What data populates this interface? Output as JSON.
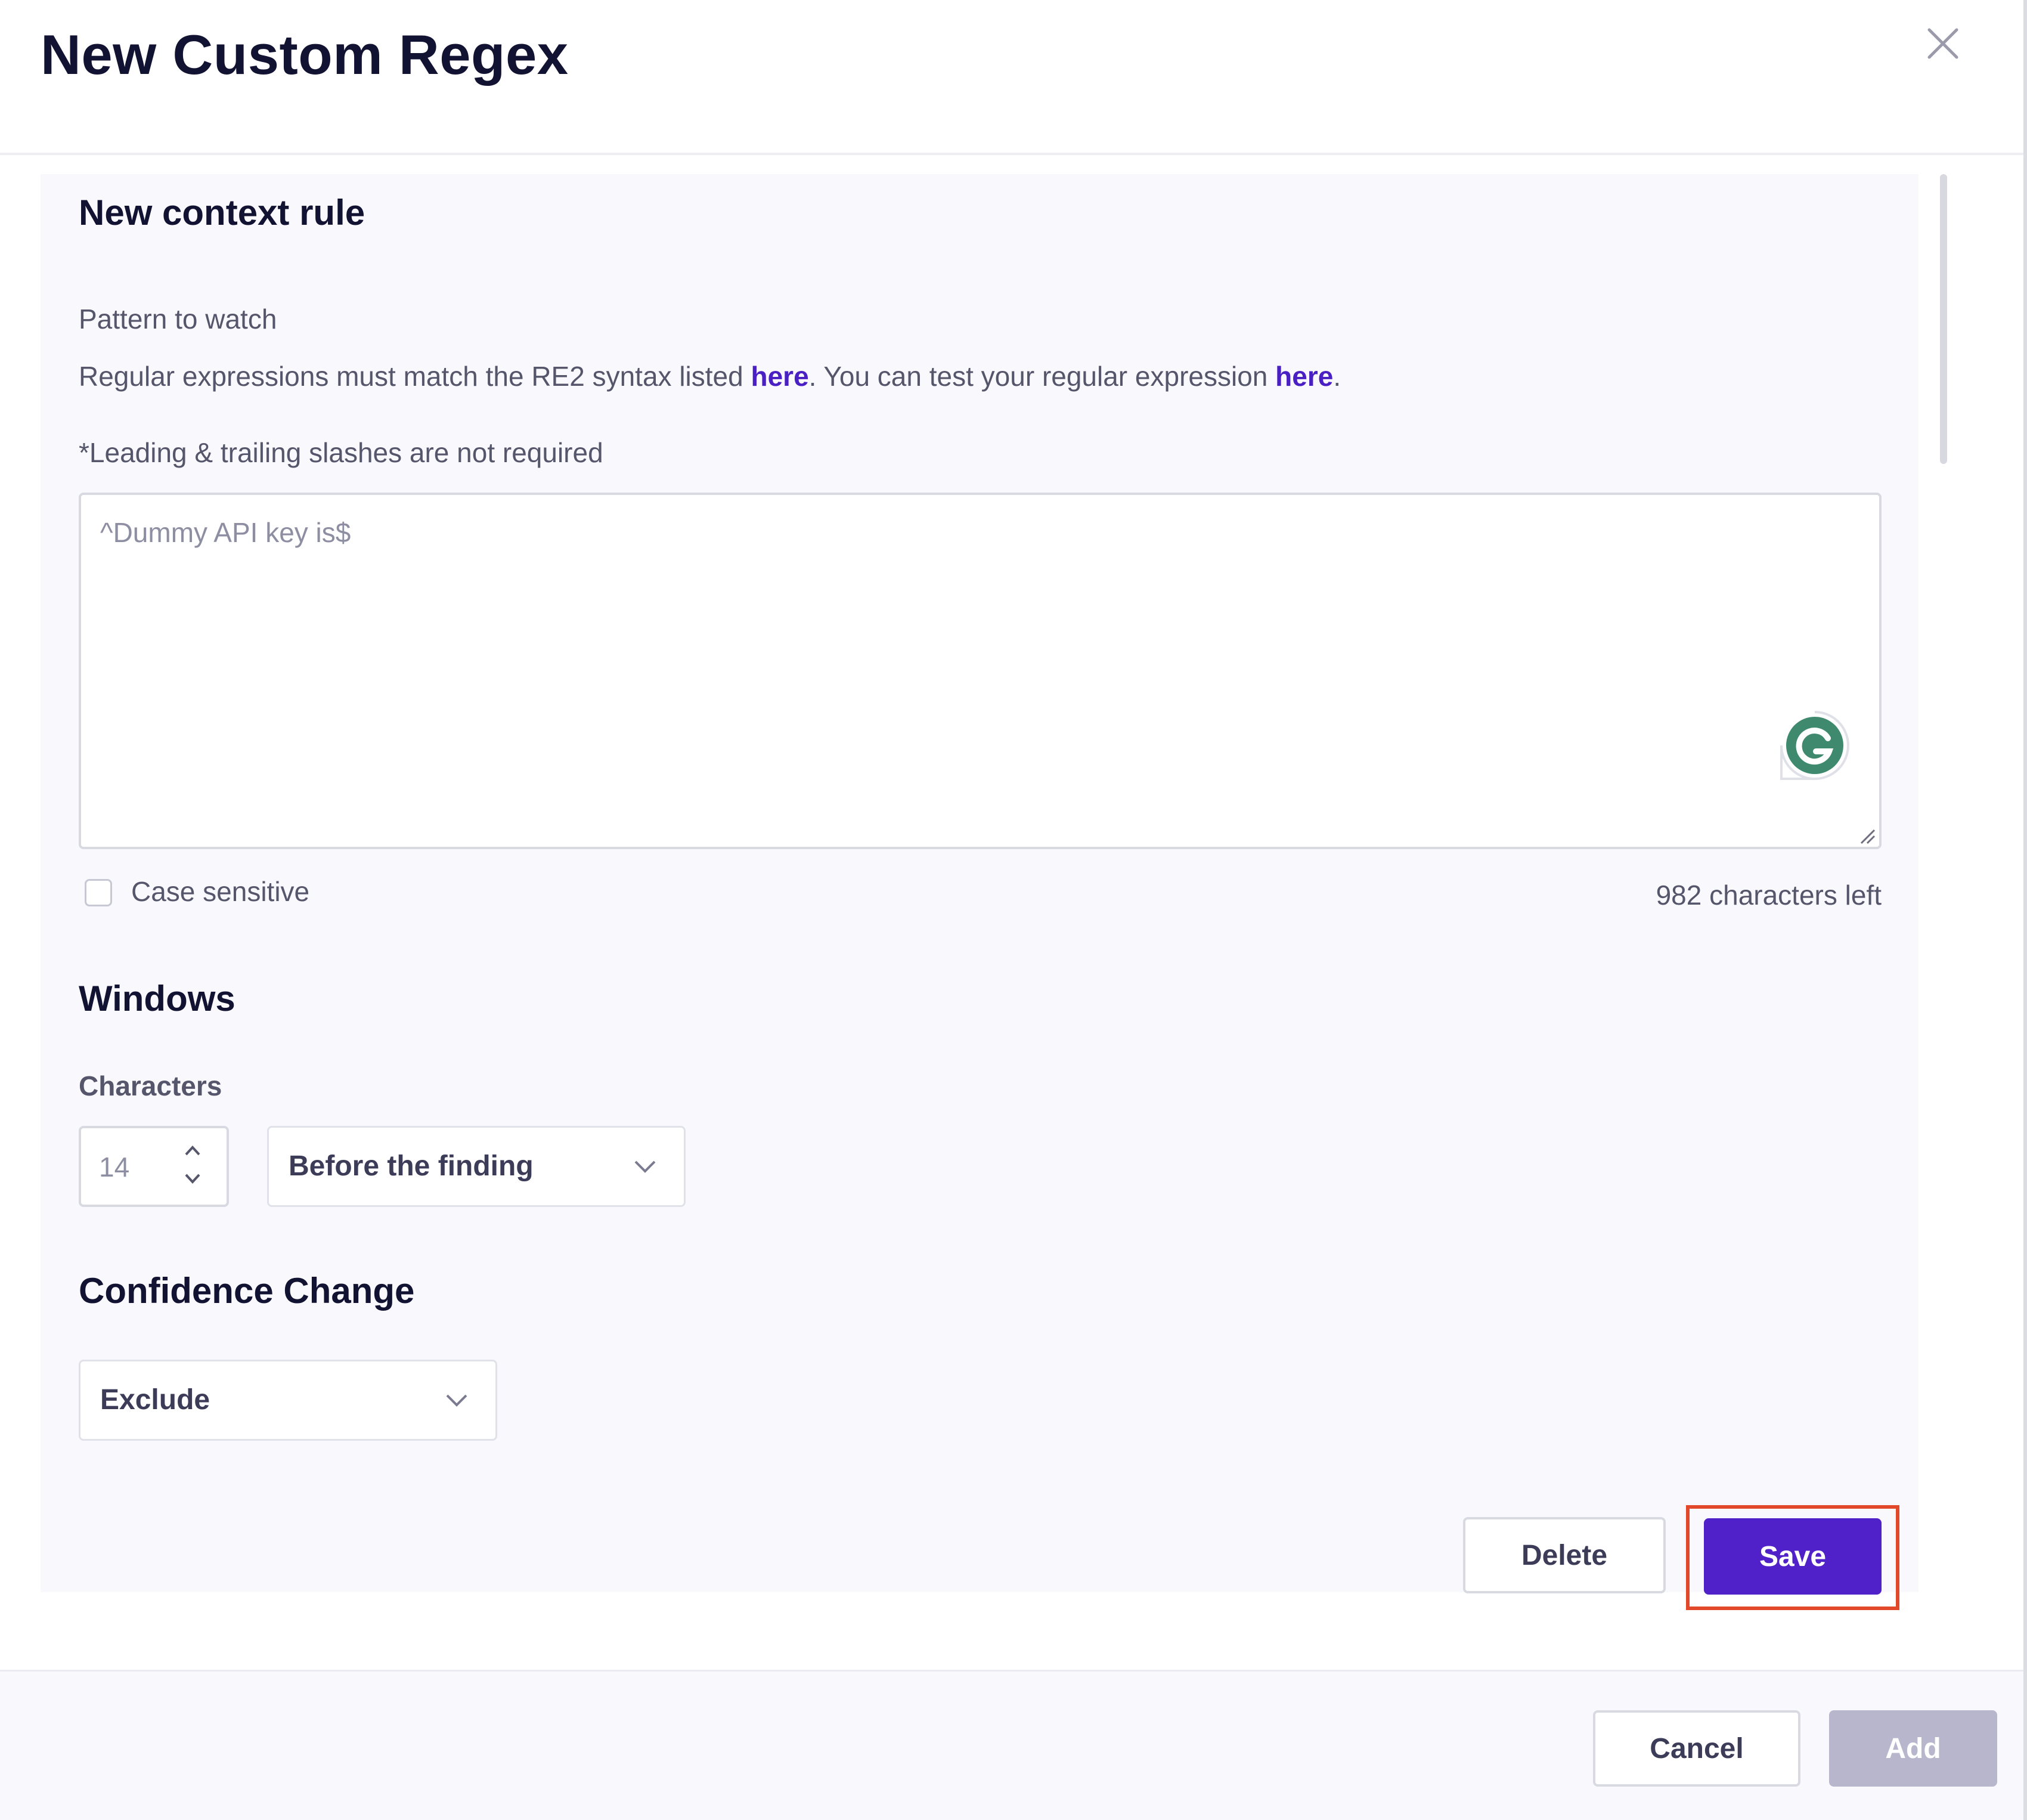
{
  "modal": {
    "title": "New Custom Regex"
  },
  "context_rule": {
    "title": "New context rule",
    "pattern_label": "Pattern to watch",
    "help_prefix": "Regular expressions must match the RE2 syntax listed ",
    "help_link_1": "here",
    "help_middle": ". You can test your regular expression ",
    "help_link_2": "here",
    "help_suffix": ".",
    "note": "*Leading & trailing slashes are not required",
    "pattern_placeholder": "^Dummy API key is$",
    "case_sensitive_label": "Case sensitive",
    "case_sensitive_checked": false,
    "chars_left": "982 characters left"
  },
  "windows": {
    "title": "Windows",
    "characters_label": "Characters",
    "characters_value": "14",
    "position_selected": "Before the finding"
  },
  "confidence": {
    "title": "Confidence Change",
    "selected": "Exclude"
  },
  "rule_actions": {
    "delete_label": "Delete",
    "save_label": "Save"
  },
  "footer": {
    "cancel_label": "Cancel",
    "add_label": "Add"
  },
  "icons": {
    "close": "close-icon",
    "stepper_up": "chevron-up-icon",
    "stepper_down": "chevron-down-icon",
    "select_chevron": "chevron-down-icon",
    "grammarly": "grammarly-icon",
    "resize": "resize-grip-icon"
  },
  "colors": {
    "primary": "#5020c8",
    "link": "#4a20c4",
    "highlight": "#e2492a",
    "disabled": "#b7b6cc",
    "grammarly": "#15a58a"
  }
}
